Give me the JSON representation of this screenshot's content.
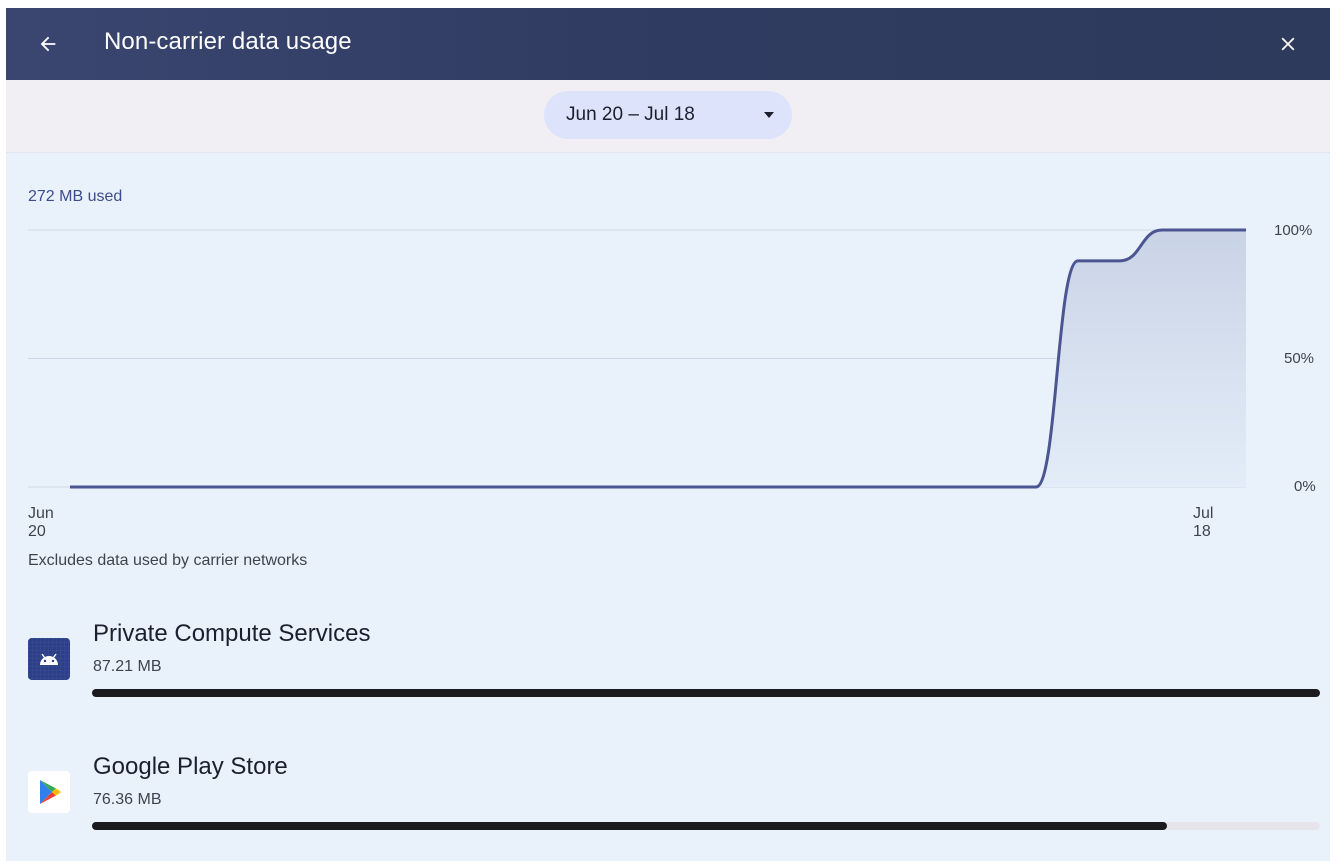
{
  "header": {
    "back_icon": "arrow-back-icon",
    "title": "Non-carrier data usage",
    "close_icon": "close-icon"
  },
  "date_range": {
    "label": "Jun 20 – Jul 18",
    "dropdown_icon": "caret-down-icon"
  },
  "usage": {
    "used_label": "272 MB used",
    "note": "Excludes data used by carrier networks"
  },
  "chart_data": {
    "type": "area",
    "title": "",
    "xlabel": "",
    "ylabel": "",
    "x_tick_labels": [
      "Jun 20",
      "Jul 18"
    ],
    "y_tick_labels": [
      "100%",
      "50%",
      "0%"
    ],
    "ylim": [
      0,
      100
    ],
    "grid": true,
    "series": [
      {
        "values_by_day": [
          {
            "x": "Jun 20",
            "y": 0
          },
          {
            "x": "Jul 13",
            "y": 0
          },
          {
            "x": "Jul 14",
            "y": 88
          },
          {
            "x": "Jul 15",
            "y": 88
          },
          {
            "x": "Jul 16",
            "y": 100
          },
          {
            "x": "Jul 18",
            "y": 100
          }
        ]
      }
    ]
  },
  "apps": [
    {
      "name": "Private Compute Services",
      "size": "87.21 MB",
      "usage_fraction": 1.0,
      "icon": "android-icon",
      "icon_color": "#2d3f85"
    },
    {
      "name": "Google Play Store",
      "size": "76.36 MB",
      "usage_fraction": 0.875,
      "icon": "play-store-icon",
      "icon_color": "#ffffff"
    }
  ]
}
